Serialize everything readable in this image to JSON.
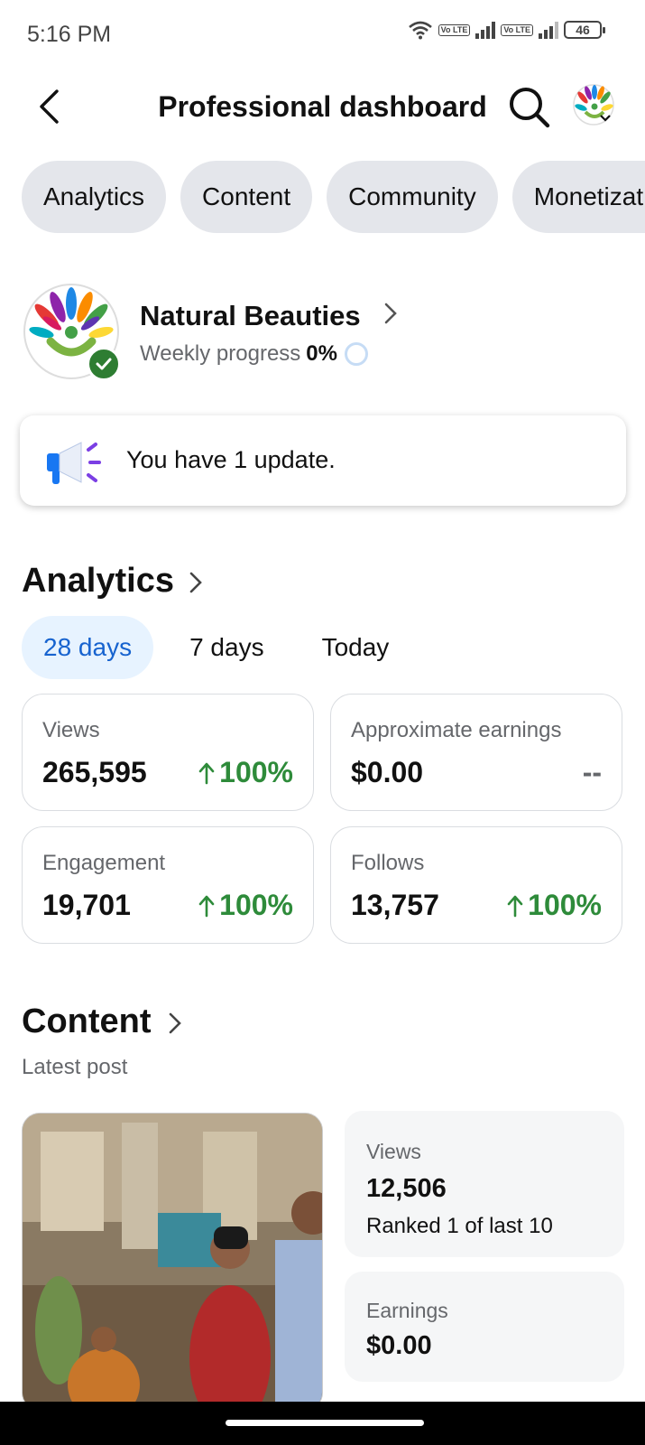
{
  "status_bar": {
    "time": "5:16 PM",
    "sim1_tag": "Vo LTE",
    "sim2_tag": "Vo LTE",
    "battery": "46"
  },
  "header": {
    "title": "Professional dashboard",
    "back_icon": "arrow-left-icon",
    "search_icon": "search-icon"
  },
  "tabs": [
    {
      "label": "Analytics"
    },
    {
      "label": "Content"
    },
    {
      "label": "Community"
    },
    {
      "label": "Monetization"
    }
  ],
  "profile": {
    "name": "Natural Beauties",
    "progress_label": "Weekly progress",
    "progress_value": "0%"
  },
  "update": {
    "text": "You have 1 update."
  },
  "analytics": {
    "title": "Analytics",
    "ranges": [
      {
        "label": "28 days",
        "active": true
      },
      {
        "label": "7 days",
        "active": false
      },
      {
        "label": "Today",
        "active": false
      }
    ],
    "metrics": [
      {
        "label": "Views",
        "value": "265,595",
        "change": "100%"
      },
      {
        "label": "Approximate earnings",
        "value": "$0.00",
        "change": "--"
      },
      {
        "label": "Engagement",
        "value": "19,701",
        "change": "100%"
      },
      {
        "label": "Follows",
        "value": "13,757",
        "change": "100%"
      }
    ]
  },
  "content": {
    "title": "Content",
    "subtitle": "Latest post",
    "views_label": "Views",
    "views_value": "12,506",
    "views_rank": "Ranked 1 of last 10",
    "earnings_label": "Earnings",
    "earnings_value": "$0.00"
  },
  "colors": {
    "accent_blue": "#1763cf",
    "chip_bg": "#e4e6eb",
    "positive_green": "#2e8b3a",
    "verified_green": "#2e7d32"
  }
}
